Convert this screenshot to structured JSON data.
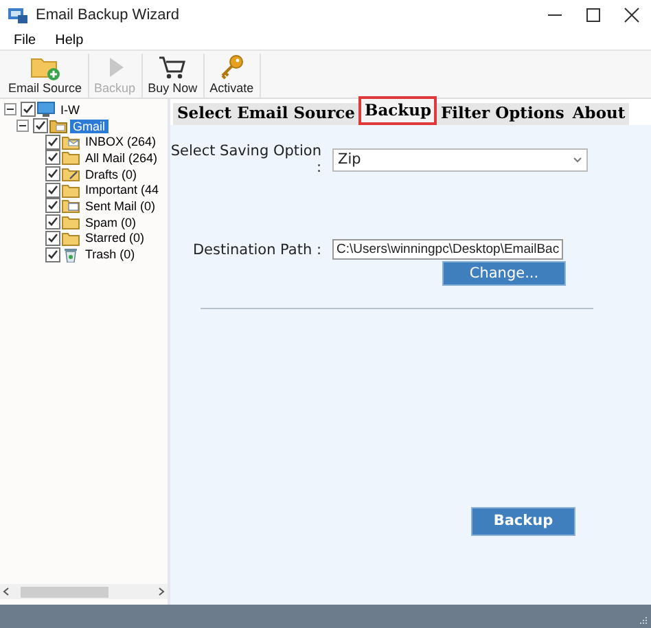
{
  "window": {
    "title": "Email Backup Wizard"
  },
  "menu": [
    {
      "label": "File"
    },
    {
      "label": "Help"
    }
  ],
  "toolbar": [
    {
      "label": "Email Source",
      "kind": "folder-add",
      "disabled": false
    },
    {
      "label": "Backup",
      "kind": "play",
      "disabled": true
    },
    {
      "label": "Buy Now",
      "kind": "cart",
      "disabled": false
    },
    {
      "label": "Activate",
      "kind": "key",
      "disabled": false
    }
  ],
  "tree": {
    "label": "I-W",
    "kind": "computer",
    "checked": true,
    "expanded": true,
    "selected": false,
    "children": [
      {
        "label": "Gmail",
        "kind": "account",
        "checked": true,
        "expanded": true,
        "selected": true,
        "children": [
          {
            "label": "INBOX (264)",
            "kind": "inbox",
            "checked": true,
            "selected": false
          },
          {
            "label": "All Mail (264)",
            "kind": "folder",
            "checked": true,
            "selected": false
          },
          {
            "label": "Drafts (0)",
            "kind": "drafts",
            "checked": true,
            "selected": false
          },
          {
            "label": "Important (44",
            "kind": "folder",
            "checked": true,
            "selected": false
          },
          {
            "label": "Sent Mail (0)",
            "kind": "sent",
            "checked": true,
            "selected": false
          },
          {
            "label": "Spam (0)",
            "kind": "folder",
            "checked": true,
            "selected": false
          },
          {
            "label": "Starred (0)",
            "kind": "folder",
            "checked": true,
            "selected": false
          },
          {
            "label": "Trash (0)",
            "kind": "trash",
            "checked": true,
            "selected": false
          }
        ]
      }
    ]
  },
  "tabs": [
    {
      "label": "Select Email Source",
      "selected": false
    },
    {
      "label": "Backup",
      "selected": true
    },
    {
      "label": "Filter Options",
      "selected": false
    },
    {
      "label": "About",
      "selected": false
    }
  ],
  "backup": {
    "saving_option": {
      "label": "Select Saving Option :",
      "value": "Zip"
    },
    "destination": {
      "label": "Destination Path :",
      "value": "C:\\Users\\winningpc\\Desktop\\EmailBac"
    },
    "change_button": "Change...",
    "backup_button": "Backup"
  }
}
